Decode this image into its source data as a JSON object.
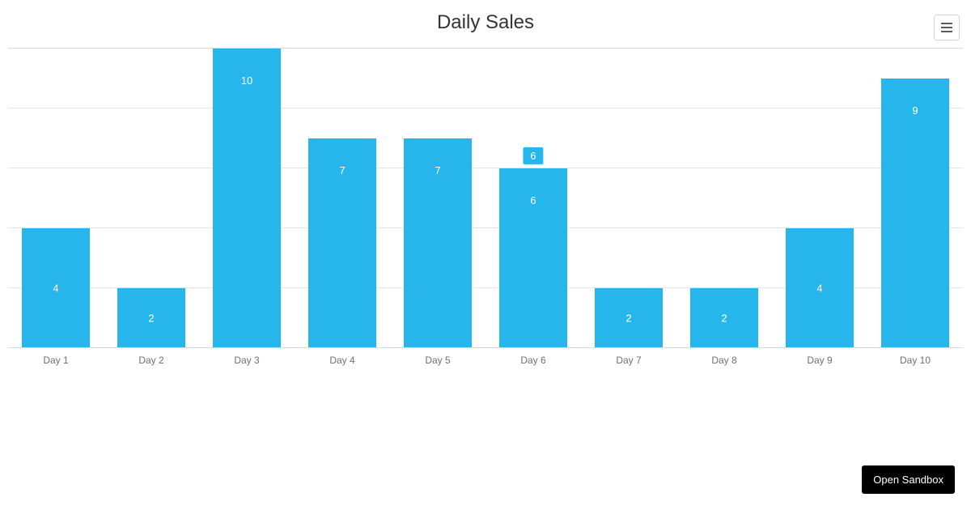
{
  "chart_data": {
    "type": "bar",
    "title": "Daily Sales",
    "categories": [
      "Day 1",
      "Day 2",
      "Day 3",
      "Day 4",
      "Day 5",
      "Day 6",
      "Day 7",
      "Day 8",
      "Day 9",
      "Day 10"
    ],
    "values": [
      4,
      2,
      10,
      7,
      7,
      6,
      2,
      2,
      4,
      9
    ],
    "ylim": [
      0,
      10
    ],
    "gridline_values": [
      2,
      4,
      6,
      8,
      10
    ],
    "bar_color": "#26b6ec",
    "highlighted_index": 5,
    "highlighted_value": "6"
  },
  "ui": {
    "open_sandbox_label": "Open Sandbox"
  }
}
